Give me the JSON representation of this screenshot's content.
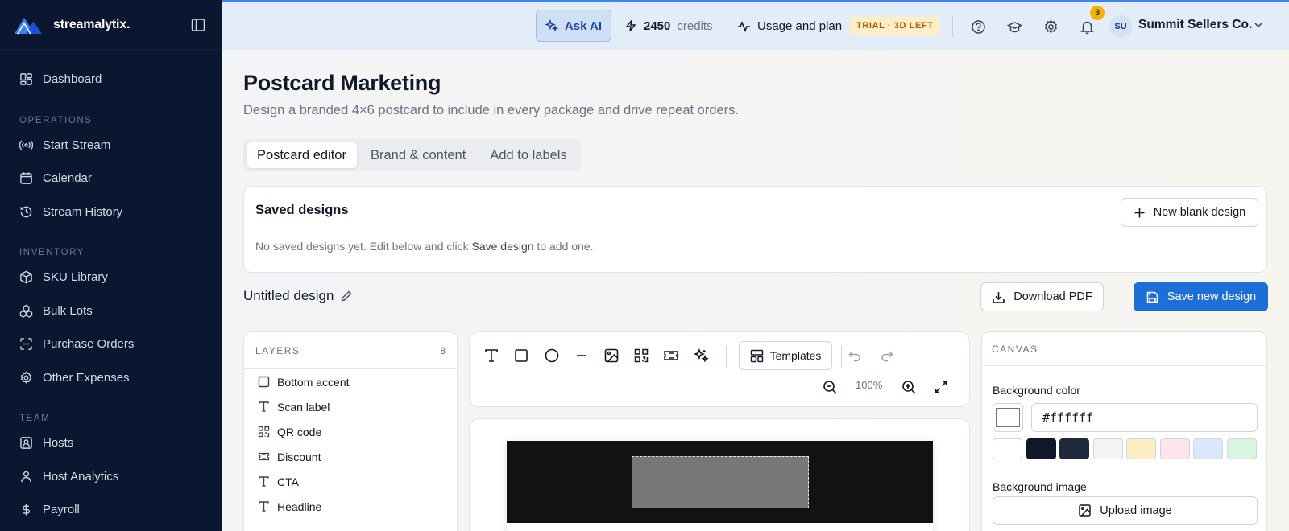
{
  "brand": {
    "name": "streamalytix."
  },
  "sidebar": {
    "items": [
      {
        "label": "Dashboard",
        "icon": "dashboard-icon"
      },
      {
        "section": "OPERATIONS"
      },
      {
        "label": "Start Stream",
        "icon": "broadcast-icon"
      },
      {
        "label": "Calendar",
        "icon": "calendar-icon"
      },
      {
        "label": "Stream History",
        "icon": "history-icon"
      },
      {
        "section": "INVENTORY"
      },
      {
        "label": "SKU Library",
        "icon": "box-icon"
      },
      {
        "label": "Bulk Lots",
        "icon": "boxes-icon"
      },
      {
        "label": "Purchase Orders",
        "icon": "scan-icon"
      },
      {
        "label": "Other Expenses",
        "icon": "gear-icon"
      },
      {
        "section": "TEAM"
      },
      {
        "label": "Hosts",
        "icon": "user-square-icon"
      },
      {
        "label": "Host Analytics",
        "icon": "analytics-icon"
      },
      {
        "label": "Payroll",
        "icon": "dollar-icon"
      }
    ]
  },
  "topbar": {
    "ask_ai": "Ask AI",
    "credits_value": "2450",
    "credits_label": "credits",
    "usage_label": "Usage and plan",
    "trial_badge": "TRIAL · 3D LEFT",
    "notification_count": "3",
    "avatar_initials": "SU",
    "account_name": "Summit Sellers Co."
  },
  "page": {
    "title": "Postcard Marketing",
    "subtitle": "Design a branded 4×6 postcard to include in every package and drive repeat orders.",
    "tabs": [
      {
        "label": "Postcard editor",
        "active": true
      },
      {
        "label": "Brand & content",
        "active": false
      },
      {
        "label": "Add to labels",
        "active": false
      }
    ]
  },
  "saved_designs": {
    "title": "Saved designs",
    "new_button": "New blank design",
    "empty_prefix": "No saved designs yet. Edit below and click ",
    "empty_link": "Save design",
    "empty_suffix": " to add one."
  },
  "design": {
    "name": "Untitled design",
    "download_button": "Download PDF",
    "save_button": "Save new design"
  },
  "layers": {
    "header": "LAYERS",
    "count": "8",
    "items": [
      {
        "label": "Bottom accent",
        "icon": "square-icon"
      },
      {
        "label": "Scan label",
        "icon": "text-icon"
      },
      {
        "label": "QR code",
        "icon": "qr-icon"
      },
      {
        "label": "Discount",
        "icon": "ticket-icon"
      },
      {
        "label": "CTA",
        "icon": "text-icon"
      },
      {
        "label": "Headline",
        "icon": "text-icon"
      }
    ]
  },
  "toolbar": {
    "templates_label": "Templates",
    "zoom_level": "100%"
  },
  "canvas_panel": {
    "header": "CANVAS",
    "bg_color_label": "Background color",
    "bg_color_value": "#ffffff",
    "swatches": [
      "#ffffff",
      "#0f172a",
      "#1e293b",
      "#f3f4f6",
      "#fdefc3",
      "#fde4ef",
      "#dbe8fb",
      "#d9f5e1"
    ],
    "bg_image_label": "Background image",
    "upload_button": "Upload image"
  },
  "colors": {
    "accent": "#1d6fd8",
    "sidebar_bg": "#0b1630",
    "topbar_bg": "#e3edf8"
  }
}
